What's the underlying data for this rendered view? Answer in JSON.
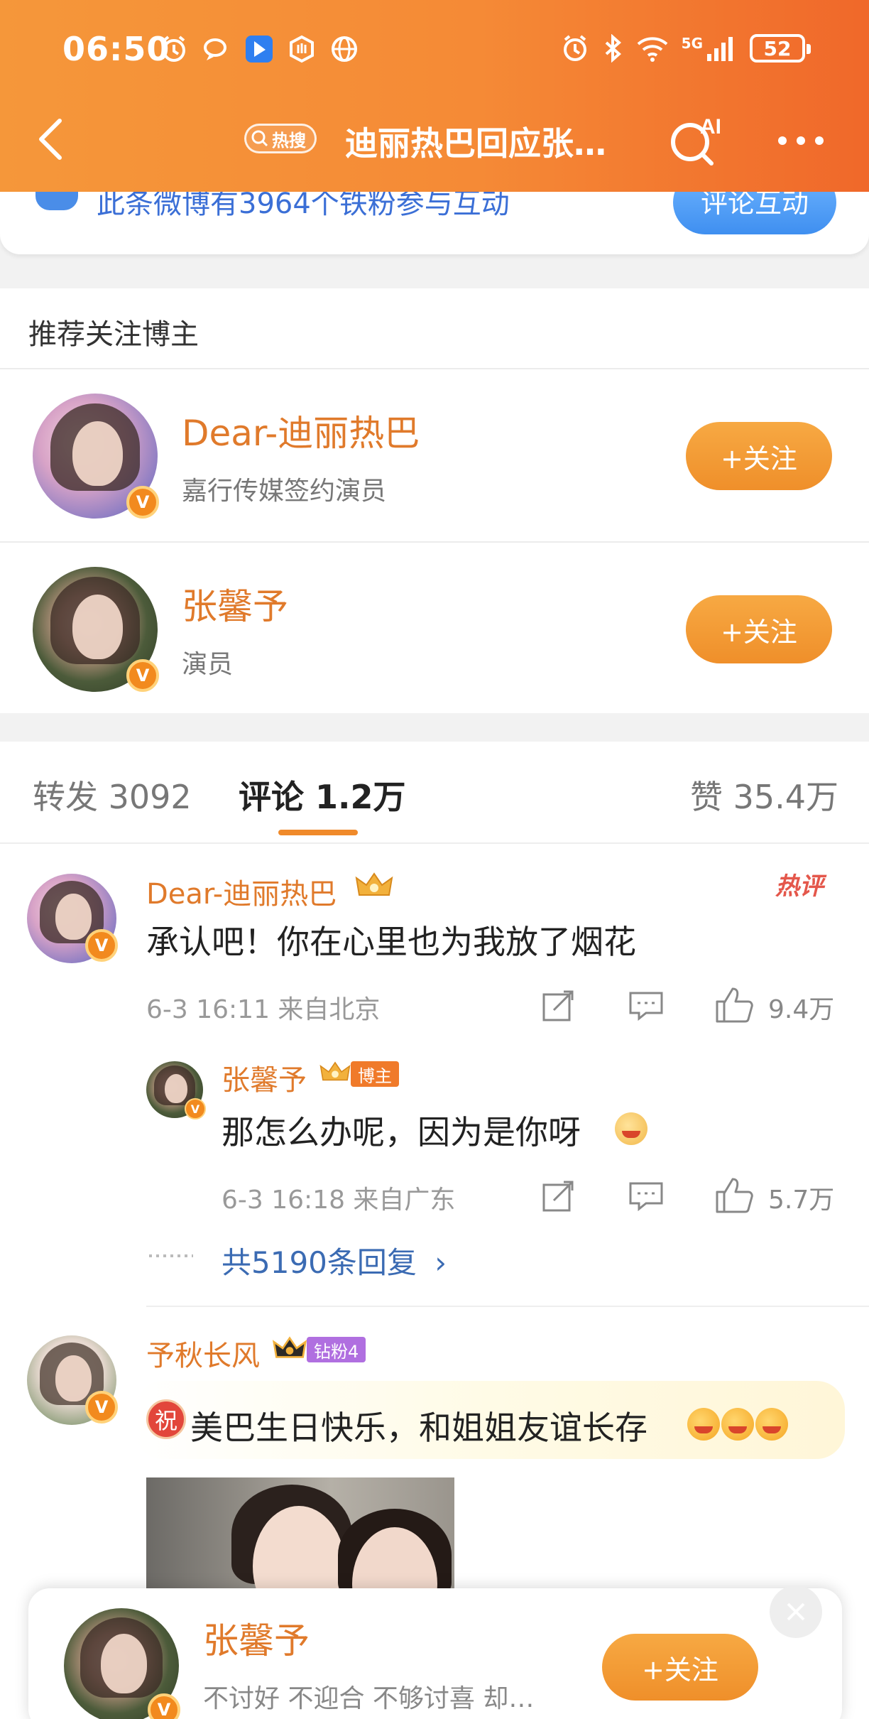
{
  "status_bar": {
    "time": "06:50",
    "network_label": "5G",
    "battery": "52",
    "icons_left": [
      "alarm-icon",
      "chat-icon",
      "app-icon",
      "hand-icon",
      "globe-icon"
    ],
    "icons_right": [
      "alarm-icon",
      "bluetooth-icon",
      "wifi-icon",
      "signal-icon",
      "battery-icon"
    ]
  },
  "nav": {
    "hot_tag": "热搜",
    "title": "迪丽热巴回应张…"
  },
  "interact": {
    "text": "此条微博有3964个铁粉参与互动",
    "button": "评论互动"
  },
  "recommend": {
    "title": "推荐关注博主",
    "items": [
      {
        "name": "Dear-迪丽热巴",
        "desc": "嘉行传媒签约演员",
        "follow": "+关注"
      },
      {
        "name": "张馨予",
        "desc": "演员",
        "follow": "+关注"
      }
    ]
  },
  "tabs": {
    "repost": "转发 3092",
    "comment": "评论 1.2万",
    "like": "赞 35.4万"
  },
  "comments": [
    {
      "name": "Dear-迪丽热巴",
      "badge": "热评",
      "text": "承认吧！你在心里也为我放了烟花",
      "meta": "6-3 16:11  来自北京",
      "likes": "9.4万"
    },
    {
      "name": "张馨予",
      "tag": "博主",
      "text": "那怎么办呢，因为是你呀",
      "meta": "6-3 16:18  来自广东",
      "likes": "5.7万"
    },
    {
      "name": "予秋长风",
      "tag": "钻粉4",
      "wish": "祝",
      "text": "美巴生日快乐，和姐姐友谊长存"
    }
  ],
  "reply_count": "共5190条回复",
  "float_card": {
    "name": "张馨予",
    "desc": "不讨好 不迎合 不够讨喜 却…",
    "follow": "+关注"
  }
}
